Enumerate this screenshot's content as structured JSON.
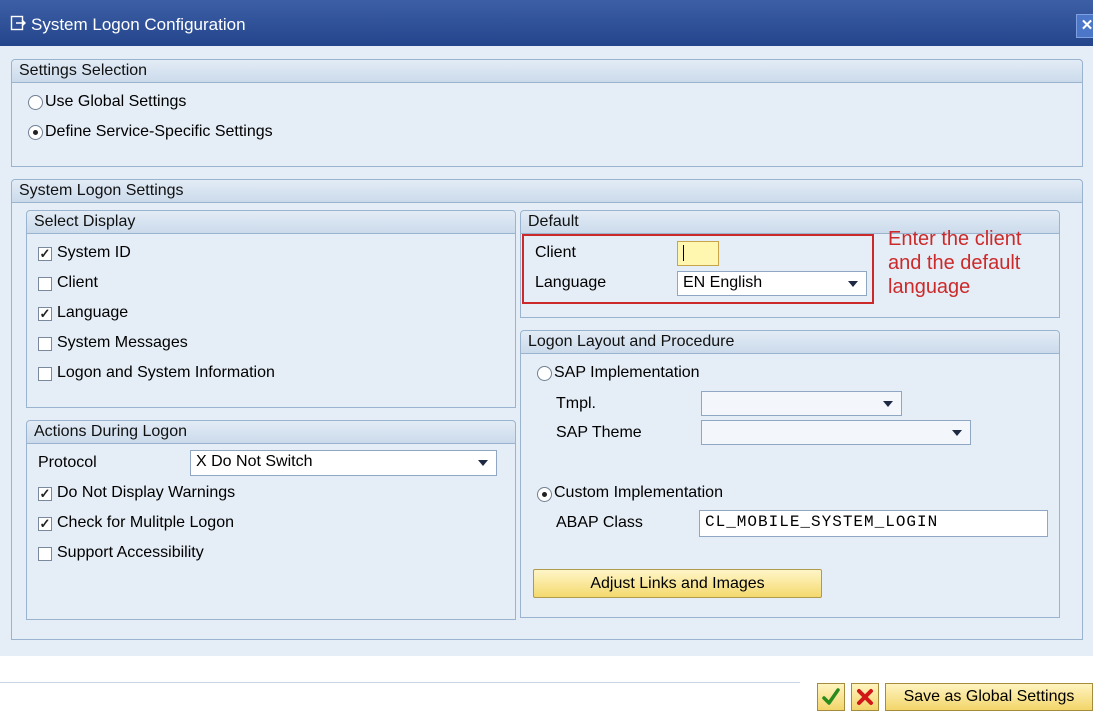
{
  "window": {
    "title": "System Logon Configuration"
  },
  "settings_selection": {
    "header": "Settings Selection",
    "use_global": "Use Global Settings",
    "define_specific": "Define Service-Specific Settings",
    "selected": "define_specific"
  },
  "system_logon_settings": {
    "header": "System Logon Settings"
  },
  "select_display": {
    "header": "Select Display",
    "items": [
      {
        "label": "System ID",
        "checked": true
      },
      {
        "label": "Client",
        "checked": false
      },
      {
        "label": "Language",
        "checked": true
      },
      {
        "label": "System Messages",
        "checked": false
      },
      {
        "label": "Logon and System Information",
        "checked": false
      }
    ]
  },
  "actions_during_logon": {
    "header": "Actions During Logon",
    "protocol_label": "Protocol",
    "protocol_value": "X Do Not Switch",
    "items": [
      {
        "label": "Do Not Display Warnings",
        "checked": true
      },
      {
        "label": "Check for Mulitple Logon",
        "checked": true
      },
      {
        "label": "Support Accessibility",
        "checked": false
      }
    ]
  },
  "default": {
    "header": "Default",
    "client_label": "Client",
    "client_value": "",
    "language_label": "Language",
    "language_value": "EN English"
  },
  "annotation": {
    "line1": "Enter the client",
    "line2": "and the default",
    "line3": "language",
    "color": "#cc2a2a"
  },
  "logon_layout": {
    "header": "Logon Layout and Procedure",
    "sap_impl": "SAP Implementation",
    "tmpl_label": "Tmpl.",
    "tmpl_value": "",
    "theme_label": "SAP Theme",
    "theme_value": "",
    "custom_impl": "Custom Implementation",
    "selected": "custom",
    "abap_label": "ABAP Class",
    "abap_value": "CL_MOBILE_SYSTEM_LOGIN",
    "adjust_button": "Adjust Links and Images"
  },
  "toolbar": {
    "ok_icon": "checkmark-icon",
    "cancel_icon": "cancel-x-icon",
    "save_global": "Save as Global Settings"
  }
}
